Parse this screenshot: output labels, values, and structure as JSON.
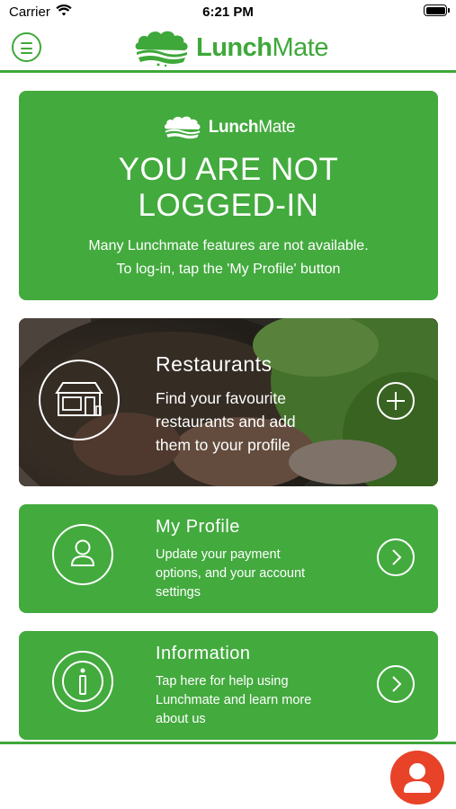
{
  "status_bar": {
    "carrier": "Carrier",
    "time": "6:21 PM"
  },
  "header": {
    "logo_bold": "Lunch",
    "logo_light": "Mate"
  },
  "notice": {
    "logo_bold": "Lunch",
    "logo_light": "Mate",
    "headline_line1": "YOU ARE NOT",
    "headline_line2": "LOGGED-IN",
    "line1": "Many Lunchmate features are not available.",
    "line2": "To log-in, tap the 'My Profile' button"
  },
  "cards": {
    "restaurants": {
      "title": "Restaurants",
      "line1": "Find your favourite",
      "line2": "restaurants and add",
      "line3": "them to your profile"
    },
    "profile": {
      "title": "My Profile",
      "line1": "Update your payment",
      "line2": "options, and your account",
      "line3": "settings"
    },
    "info": {
      "title": "Information",
      "line1": "Tap here for help using",
      "line2": "Lunchmate and learn more",
      "line3": "about us"
    }
  },
  "colors": {
    "brand_green": "#43aa3e",
    "line_green": "#3fa83a",
    "accent_red": "#e84229"
  },
  "icons": [
    "wifi-icon",
    "battery-icon",
    "menu-icon",
    "cloud-logo-icon",
    "store-icon",
    "plus-icon",
    "user-icon",
    "chevron-right-icon",
    "info-icon",
    "avatar-icon"
  ]
}
